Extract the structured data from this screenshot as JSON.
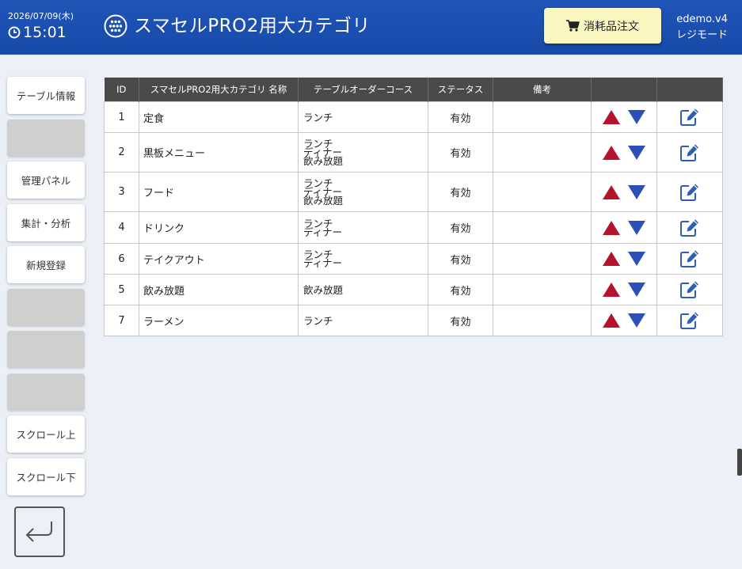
{
  "header": {
    "date": "2026/07/09(木)",
    "time": "15:01",
    "title": "スマセルPRO2用大カテゴリ",
    "order_button": "消耗品注文",
    "user": "edemo.v4",
    "mode": "レジモード"
  },
  "sidebar": {
    "table_info": "テーブル情報",
    "admin_panel": "管理パネル",
    "analytics": "集計・分析",
    "new_register": "新規登録",
    "scroll_up": "スクロール上",
    "scroll_down": "スクロール下"
  },
  "table": {
    "headers": [
      "ID",
      "スマセルPRO2用大カテゴリ 名称",
      "テーブルオーダーコース",
      "ステータス",
      "備考",
      "",
      ""
    ],
    "rows": [
      {
        "id": "1",
        "name": "定食",
        "courses": [
          "ランチ"
        ],
        "status": "有効",
        "note": ""
      },
      {
        "id": "2",
        "name": "黒板メニュー",
        "courses": [
          "ランチ",
          "ディナー",
          "飲み放題"
        ],
        "status": "有効",
        "note": ""
      },
      {
        "id": "3",
        "name": "フード",
        "courses": [
          "ランチ",
          "ディナー",
          "飲み放題"
        ],
        "status": "有効",
        "note": ""
      },
      {
        "id": "4",
        "name": "ドリンク",
        "courses": [
          "ランチ",
          "ディナー"
        ],
        "status": "有効",
        "note": ""
      },
      {
        "id": "6",
        "name": "テイクアウト",
        "courses": [
          "ランチ",
          "ディナー"
        ],
        "status": "有効",
        "note": ""
      },
      {
        "id": "5",
        "name": "飲み放題",
        "courses": [
          "飲み放題"
        ],
        "status": "有効",
        "note": ""
      },
      {
        "id": "7",
        "name": "ラーメン",
        "courses": [
          "ランチ"
        ],
        "status": "有効",
        "note": ""
      }
    ]
  },
  "icons": {
    "up": "up-arrow-icon",
    "down": "down-arrow-icon",
    "edit": "edit-icon",
    "back": "back-arrow-icon"
  },
  "colors": {
    "header_bg": "#1f55b8",
    "order_button_bg": "#fbf7c0",
    "up_arrow": "#b5132b",
    "down_arrow": "#2d4fb8",
    "edit_icon": "#2d5fb3"
  }
}
